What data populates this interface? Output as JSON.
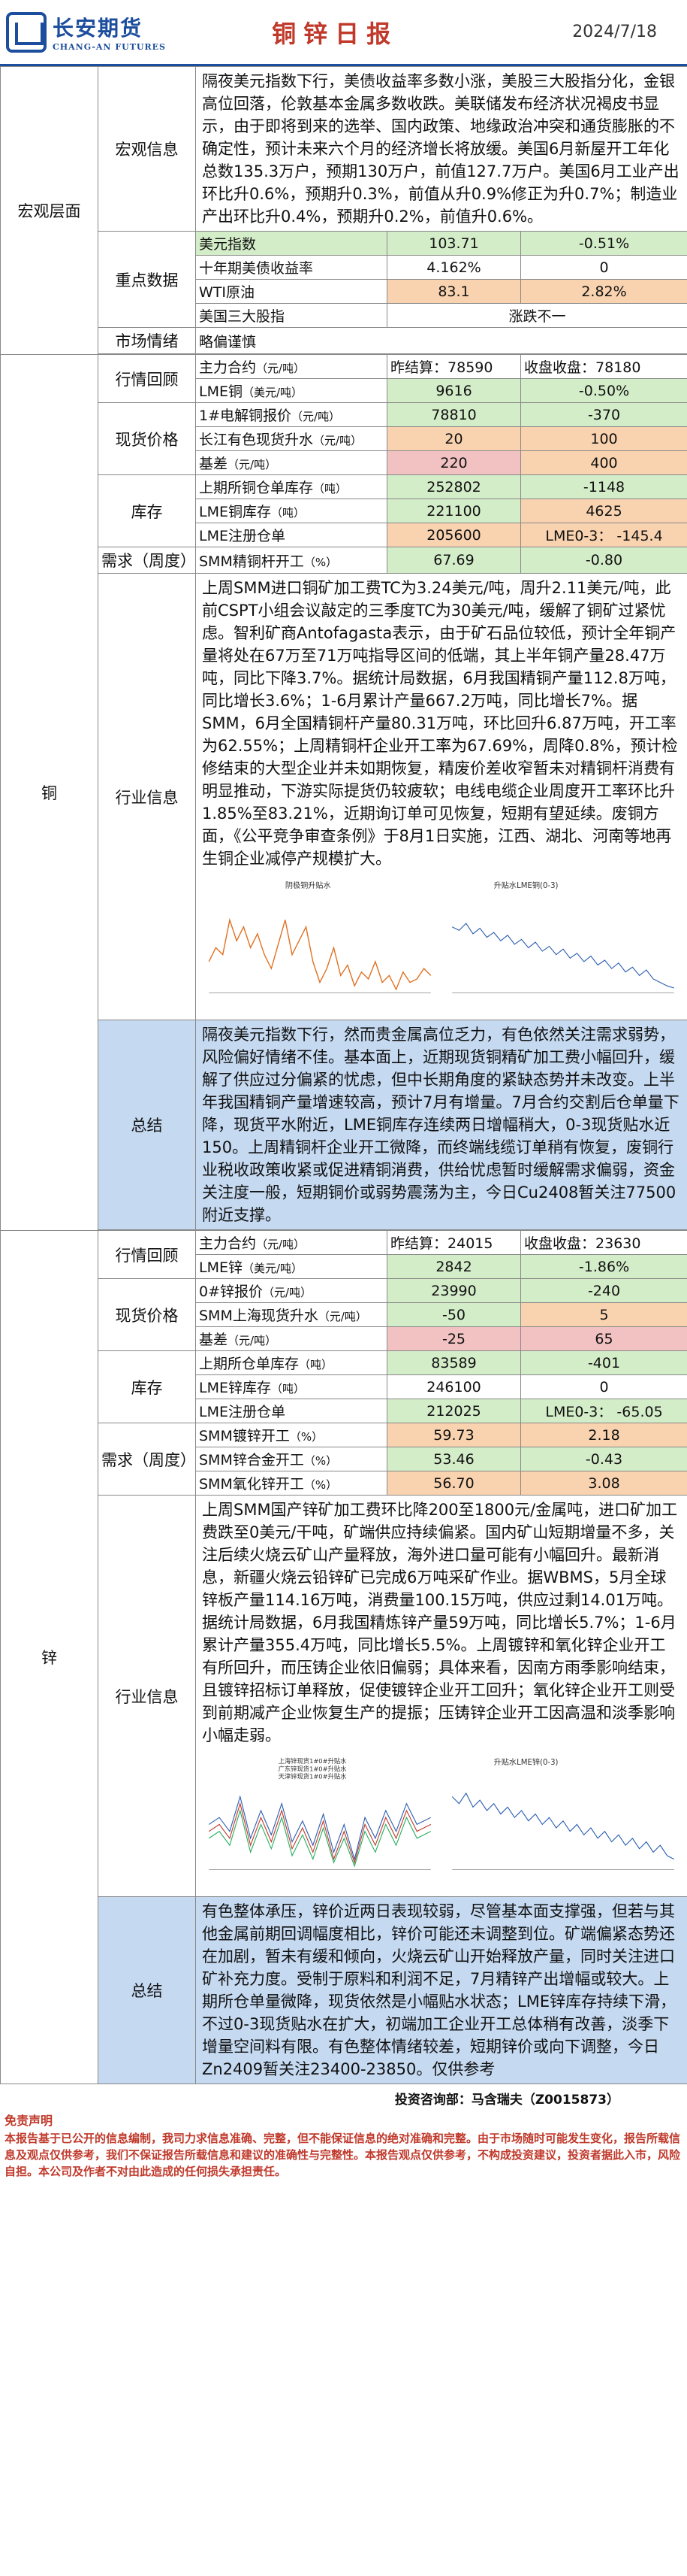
{
  "header": {
    "logo_cn": "长安期货",
    "logo_en": "CHANG-AN FUTURES",
    "title": "铜锌日报",
    "date": "2024/7/18"
  },
  "macro": {
    "section": "宏观层面",
    "info_label": "宏观信息",
    "info_text": "隔夜美元指数下行，美债收益率多数小涨，美股三大股指分化，金银高位回落，伦敦基本金属多数收跌。美联储发布经济状况褐皮书显示，由于即将到来的选举、国内政策、地缘政治冲突和通货膨胀的不确定性，预计未来六个月的经济增长将放缓。美国6月新屋开工年化总数135.3万户，预期130万户，前值127.7万户。美国6月工业产出环比升0.6%，预期升0.3%，前值从升0.9%修正为升0.7%；制造业产出环比升0.4%，预期升0.2%，前值升0.6%。",
    "key_label": "重点数据",
    "key_rows": [
      {
        "name": "美元指数",
        "v1": "103.71",
        "v2": "-0.51%"
      },
      {
        "name": "十年期美债收益率",
        "v1": "4.162%",
        "v2": "0"
      },
      {
        "name": "WTI原油",
        "v1": "83.1",
        "v2": "2.82%"
      },
      {
        "name": "美国三大股指",
        "v1": "涨跌不一",
        "v2": ""
      }
    ],
    "sentiment_label": "市场情绪",
    "sentiment_value": "略偏谨慎"
  },
  "copper": {
    "section": "铜",
    "review_label": "行情回顾",
    "main_contract": "主力合约",
    "unit_yuan_t": "（元/吨）",
    "yesterday_close_label": "昨结算：",
    "yesterday_close": "78590",
    "today_close_label": "收盘收盘：",
    "today_close": "78180",
    "lme_label": "LME铜",
    "unit_usd_t": "（美元/吨）",
    "lme_v1": "9616",
    "lme_v2": "-0.50%",
    "spot_label": "现货价格",
    "spot_rows": [
      {
        "name": "1#电解铜报价",
        "unit": "（元/吨）",
        "v1": "78810",
        "v2": "-370"
      },
      {
        "name": "长江有色现货升水",
        "unit": "（元/吨）",
        "v1": "20",
        "v2": "100"
      },
      {
        "name": "基差",
        "unit": "（元/吨）",
        "v1": "220",
        "v2": "400"
      }
    ],
    "stock_label": "库存",
    "stock_rows": [
      {
        "name": "上期所铜仓单库存",
        "unit": "（吨）",
        "v1": "252802",
        "v2": "-1148"
      },
      {
        "name": "LME铜库存",
        "unit": "（吨）",
        "v1": "221100",
        "v2": "4625"
      },
      {
        "name": "LME注册仓单",
        "unit": "",
        "v1": "205600",
        "v2": "LME0-3：  -145.4"
      }
    ],
    "demand_label": "需求（周度）",
    "demand_row": {
      "name": "SMM精铜杆开工",
      "unit": "（%）",
      "v1": "67.69",
      "v2": "-0.80"
    },
    "industry_label": "行业信息",
    "industry_text": "上周SMM进口铜矿加工费TC为3.24美元/吨，周升2.11美元/吨，此前CSPT小组会议敲定的三季度TC为30美元/吨，缓解了铜矿过紧忧虑。智利矿商Antofagasta表示，由于矿石品位较低，预计全年铜产量将处在67万至71万吨指导区间的低端，其上半年铜产量28.47万吨，同比下降3.7%。据统计局数据，6月我国精铜产量112.8万吨，同比增长3.6%；1-6月累计产量667.2万吨，同比增长7%。据SMM，6月全国精铜杆产量80.31万吨，环比回升6.87万吨，开工率为62.55%；上周精铜杆企业开工率为67.69%，周降0.8%，预计检修结束的大型企业并未如期恢复，精废价差收窄暂未对精铜杆消费有明显推动，下游实际提货仍较疲软；电线电缆企业周度开工率环比升1.85%至83.21%，近期询订单可见恢复，短期有望延续。废铜方面，《公平竞争审查条例》于8月1日实施，江西、湖北、河南等地再生铜企业减停产规模扩大。",
    "chart1_title": "阴极铜升贴水",
    "chart2_title": "升贴水LME铜(0-3)",
    "summary_label": "总结",
    "summary_text": "隔夜美元指数下行，然而贵金属高位乏力，有色依然关注需求弱势，风险偏好情绪不佳。基本面上，近期现货铜精矿加工费小幅回升，缓解了供应过分偏紧的忧虑，但中长期角度的紧缺态势并未改变。上半年我国精铜产量增速较高，预计7月有增量。7月合约交割后仓单量下降，现货平水附近，LME铜库存连续两日增幅稍大，0-3现货贴水近150。上周精铜杆企业开工微降，而终端线缆订单稍有恢复，废铜行业税收政策收紧或促进精铜消费，供给忧虑暂时缓解需求偏弱，资金关注度一般，短期铜价或弱势震荡为主，今日Cu2408暂关注77500附近支撑。"
  },
  "zinc": {
    "section": "锌",
    "review_label": "行情回顾",
    "main_contract": "主力合约",
    "unit_yuan_t": "（元/吨）",
    "yesterday_close_label": "昨结算：",
    "yesterday_close": "24015",
    "today_close_label": "收盘收盘：",
    "today_close": "23630",
    "lme_label": "LME锌",
    "unit_usd_t": "（美元/吨）",
    "lme_v1": "2842",
    "lme_v2": "-1.86%",
    "spot_label": "现货价格",
    "spot_rows": [
      {
        "name": "0#锌报价",
        "unit": "（元/吨）",
        "v1": "23990",
        "v2": "-240"
      },
      {
        "name": "SMM上海现货升水",
        "unit": "（元/吨）",
        "v1": "-50",
        "v2": "5"
      },
      {
        "name": "基差",
        "unit": "（元/吨）",
        "v1": "-25",
        "v2": "65"
      }
    ],
    "stock_label": "库存",
    "stock_rows": [
      {
        "name": "上期所仓单库存",
        "unit": "（吨）",
        "v1": "83589",
        "v2": "-401"
      },
      {
        "name": "LME锌库存",
        "unit": "（吨）",
        "v1": "246100",
        "v2": "0"
      },
      {
        "name": "LME注册仓单",
        "unit": "",
        "v1": "212025",
        "v2": "LME0-3：  -65.05"
      }
    ],
    "demand_label": "需求（周度）",
    "demand_rows": [
      {
        "name": "SMM镀锌开工",
        "unit": "（%）",
        "v1": "59.73",
        "v2": "2.18"
      },
      {
        "name": "SMM锌合金开工",
        "unit": "（%）",
        "v1": "53.46",
        "v2": "-0.43"
      },
      {
        "name": "SMM氧化锌开工",
        "unit": "（%）",
        "v1": "56.70",
        "v2": "3.08"
      }
    ],
    "industry_label": "行业信息",
    "industry_text": "上周SMM国产锌矿加工费环比降200至1800元/金属吨，进口矿加工费跌至0美元/干吨，矿端供应持续偏紧。国内矿山短期增量不多，关注后续火烧云矿山产量释放，海外进口量可能有小幅回升。最新消息，新疆火烧云铅锌矿已完成6万吨采矿作业。据WBMS，5月全球锌板产量114.16万吨，消费量100.15万吨，供应过剩14.01万吨。据统计局数据，6月我国精炼锌产量59万吨，同比增长5.7%；1-6月累计产量355.4万吨，同比增长5.5%。上周镀锌和氧化锌企业开工有所回升，而压铸企业依旧偏弱；具体来看，因南方雨季影响结束，且镀锌招标订单释放，促使镀锌企业开工回升；氧化锌企业开工则受到前期减产企业恢复生产的提振；压铸锌企业开工因高温和淡季影响小幅走弱。",
    "chart1_legend": [
      "上海锌现货1#0#升贴水",
      "广东锌现货1#0#升贴水",
      "天津锌现货1#0#升贴水"
    ],
    "chart2_title": "升贴水LME锌(0-3)",
    "summary_label": "总结",
    "summary_text": "有色整体承压，锌价近两日表现较弱，尽管基本面支撑强，但若与其他金属前期回调幅度相比，锌价可能还未调整到位。矿端偏紧态势还在加剧，暂未有缓和倾向，火烧云矿山开始释放产量，同时关注进口矿补充力度。受制于原料和利润不足，7月精锌产出增幅或较大。上期所仓单量微降，现货依然是小幅贴水状态；LME锌库存持续下滑，不过0-3现货贴水在扩大，初端加工企业开工总体稍有改善，淡季下增量空间料有限。有色整体情绪较差，短期锌价或向下调整，今日Zn2409暂关注23400-23850。仅供参考"
  },
  "footer": {
    "analyst": "投资咨询部：马含瑞夫（Z0015873）",
    "disclaimer_title": "免责声明",
    "disclaimer": "本报告基于已公开的信息编制，我司力求信息准确、完整，但不能保证信息的绝对准确和完整。由于市场随时可能发生变化，报告所载信息及观点仅供参考，我们不保证报告所载信息和建议的准确性与完整性。本报告观点仅供参考，不构成投资建议，投资者据此入市，风险自担。本公司及作者不对由此造成的任何损失承担责任。"
  },
  "colors": {
    "brand_blue": "#1d4e9e",
    "title_red": "#c0392b",
    "cell_green": "#d4edc9",
    "cell_orange": "#f9d3b0",
    "cell_rose": "#f2c2c2",
    "row_blue": "#c5d9f1"
  }
}
